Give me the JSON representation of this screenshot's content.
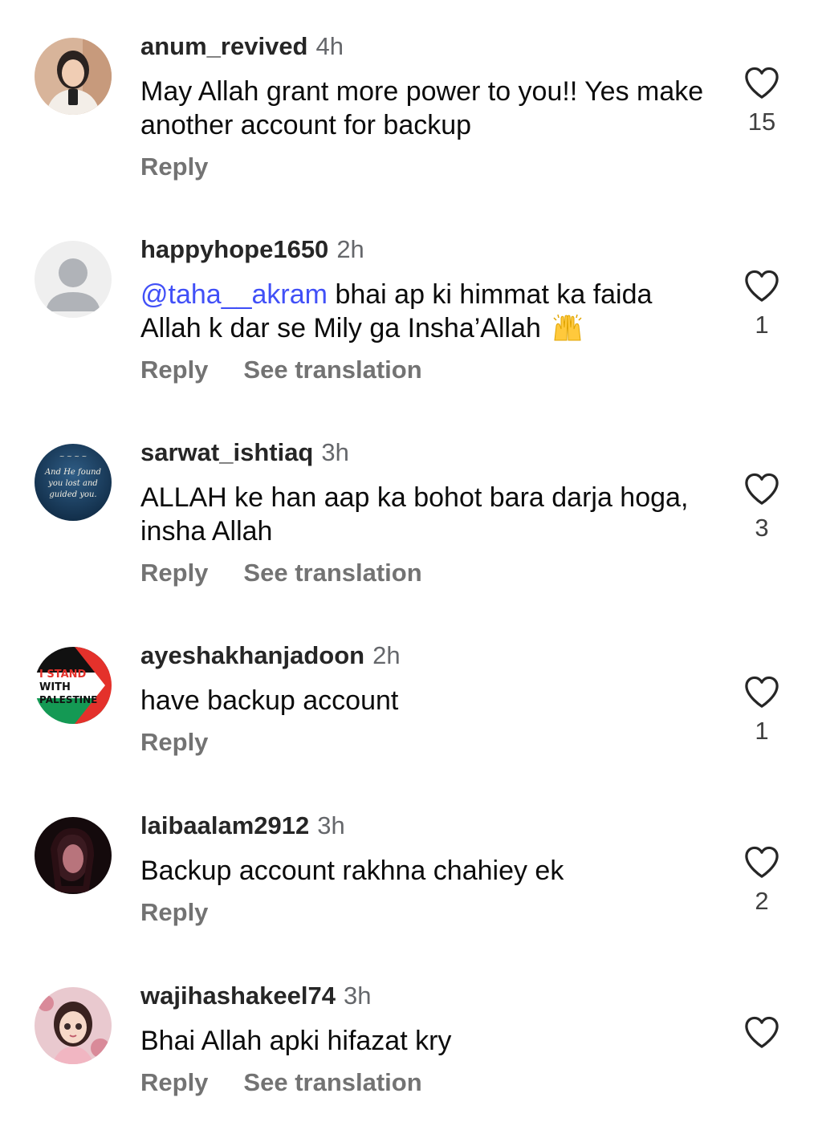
{
  "comments": [
    {
      "username": "anum_revived",
      "time": "4h",
      "text": "May Allah grant more power to you!! Yes make another account for backup",
      "reply_label": "Reply",
      "translation_label": "",
      "like_count": "15"
    },
    {
      "username": "happyhope1650",
      "time": "2h",
      "mention": "@taha__akram",
      "text": "bhai ap ki himmat ka faida Allah k dar se Mily ga Insha’Allah",
      "emoji": "raising-hands-icon",
      "reply_label": "Reply",
      "translation_label": "See translation",
      "like_count": "1"
    },
    {
      "username": "sarwat_ishtiaq",
      "time": "3h",
      "text": "ALLAH ke han aap ka bohot bara darja hoga, insha Allah",
      "avatar_text": [
        "And He found",
        "you lost and",
        "guided you."
      ],
      "reply_label": "Reply",
      "translation_label": "See translation",
      "like_count": "3"
    },
    {
      "username": "ayeshakhanjadoon",
      "time": "2h",
      "text": "have backup account",
      "avatar_text": [
        "I STAND",
        "WITH",
        "PALESTINE"
      ],
      "reply_label": "Reply",
      "translation_label": "",
      "like_count": "1"
    },
    {
      "username": "laibaalam2912",
      "time": "3h",
      "text": "Backup account rakhna chahiey ek",
      "reply_label": "Reply",
      "translation_label": "",
      "like_count": "2"
    },
    {
      "username": "wajihashakeel74",
      "time": "3h",
      "text": "Bhai Allah apki hifazat kry",
      "reply_label": "Reply",
      "translation_label": "See translation",
      "like_count": ""
    }
  ],
  "colors": {
    "mention": "#4150f7",
    "secondary_text": "#737373",
    "primary_text": "#0c0c0c"
  }
}
